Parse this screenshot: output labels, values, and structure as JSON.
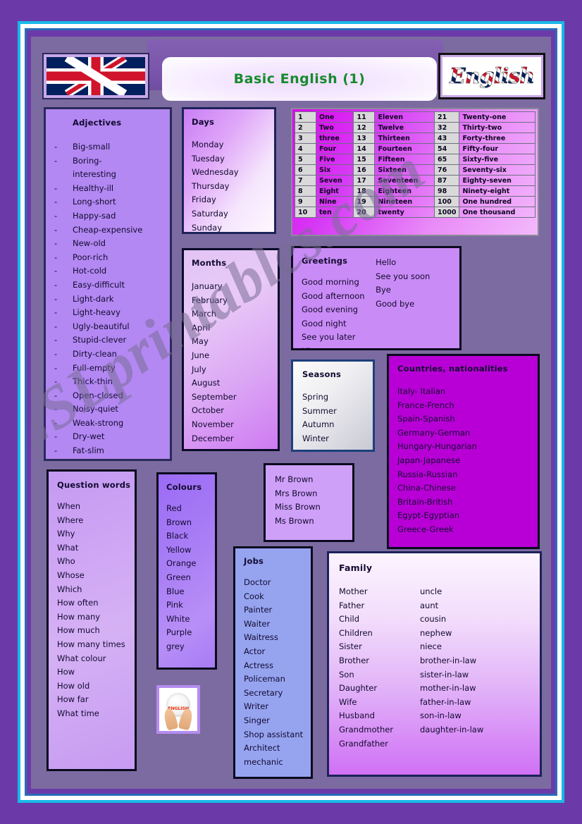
{
  "header": {
    "title": "Basic English (1)",
    "logo_text": "English",
    "flag_icon": "uk-flag-icon"
  },
  "colors": {
    "page_bg": "#6b3aa8",
    "frame_cyan": "#19b9e8",
    "frame_blue": "#2b6cb8",
    "canvas_bg": "#7c6ba0",
    "title_green": "#178a2e",
    "countries_magenta": "#b800d6",
    "jobs_blue": "#96a4f0"
  },
  "watermark": "ESLprintables.com",
  "adjectives": {
    "title": "Adjectives",
    "items": [
      "Big-small",
      "Boring-",
      "interesting",
      "Healthy-ill",
      "Long-short",
      "Happy-sad",
      "Cheap-expensive",
      "New-old",
      "Poor-rich",
      "Hot-cold",
      "Easy-difficult",
      "Light-dark",
      "Light-heavy",
      "Ugly-beautiful",
      "Stupid-clever",
      "Dirty-clean",
      "Full-empty",
      "Thick-thin",
      "Open-closed",
      "Noisy-quiet",
      "Weak-strong",
      "Dry-wet",
      "Fat-slim"
    ],
    "dashed": [
      true,
      true,
      false,
      true,
      true,
      true,
      true,
      true,
      true,
      true,
      true,
      true,
      true,
      true,
      true,
      true,
      true,
      true,
      true,
      true,
      true,
      true,
      true
    ]
  },
  "days": {
    "title": "Days",
    "items": [
      "Monday",
      "Tuesday",
      "Wednesday",
      "Thursday",
      "Friday",
      "Saturday",
      "Sunday"
    ]
  },
  "months": {
    "title": "Months",
    "items": [
      "January",
      "February",
      "March",
      "April",
      "May",
      "June",
      "July",
      "August",
      "September",
      "October",
      "November",
      "December"
    ]
  },
  "numbers": {
    "rows": [
      [
        "1",
        "One",
        "11",
        "Eleven",
        "21",
        "Twenty-one"
      ],
      [
        "2",
        "Two",
        "12",
        "Twelve",
        "32",
        "Thirty-two"
      ],
      [
        "3",
        "three",
        "13",
        "Thirteen",
        "43",
        "Forty-three"
      ],
      [
        "4",
        "Four",
        "14",
        "Fourteen",
        "54",
        "Fifty-four"
      ],
      [
        "5",
        "Five",
        "15",
        "Fifteen",
        "65",
        "Sixty-five"
      ],
      [
        "6",
        "Six",
        "16",
        "Sixteen",
        "76",
        "Seventy-six"
      ],
      [
        "7",
        "Seven",
        "17",
        "Seventeen",
        "87",
        "Eighty-seven"
      ],
      [
        "8",
        "Eight",
        "18",
        "Eighteen",
        "98",
        "Ninety-eight"
      ],
      [
        "9",
        "Nine",
        "19",
        "Nineteen",
        "100",
        "One hundred"
      ],
      [
        "10",
        "ten",
        "20",
        "twenty",
        "1000",
        "One thousand"
      ]
    ]
  },
  "greetings": {
    "title": "Greetings",
    "col1": [
      "Good morning",
      "Good afternoon",
      "Good evening",
      "Good night",
      "See you later",
      "Hi"
    ],
    "col2": [
      "Hello",
      "See you soon",
      "Bye",
      "Good bye"
    ]
  },
  "seasons": {
    "title": "Seasons",
    "items": [
      "Spring",
      "Summer",
      "Autumn",
      "Winter"
    ]
  },
  "countries": {
    "title": "Countries, nationalities",
    "items": [
      "Italy- Italian",
      "France-French",
      "Spain-Spanish",
      "Germany-German",
      "Hungary-Hungarian",
      "Japan-Japanese",
      "Russia-Russian",
      "China-Chinese",
      "Britain-British",
      "Egypt-Egyptian",
      "Greece-Greek"
    ]
  },
  "titles": {
    "items": [
      "Mr Brown",
      "Mrs Brown",
      "Miss Brown",
      "Ms Brown"
    ]
  },
  "question_words": {
    "title": "Question words",
    "items": [
      "When",
      "Where",
      "Why",
      "What",
      "Who",
      "Whose",
      "Which",
      "How often",
      "How many",
      "How much",
      "How many times",
      "What colour",
      "How",
      "How old",
      "How far",
      "What time"
    ]
  },
  "colours": {
    "title": "Colours",
    "items": [
      "Red",
      "Brown",
      "Black",
      "Yellow",
      "Orange",
      "Green",
      "Blue",
      "Pink",
      "White",
      "Purple",
      "grey"
    ]
  },
  "jobs": {
    "title": "Jobs",
    "items": [
      "Doctor",
      "Cook",
      "Painter",
      "Waiter",
      "Waitress",
      "Actor",
      "Actress",
      "Policeman",
      "Secretary",
      "Writer",
      "Singer",
      "Shop assistant",
      "Architect",
      "mechanic"
    ]
  },
  "family": {
    "title": "Family",
    "col1": [
      "Mother",
      "Father",
      "Child",
      "Children",
      "Sister",
      "Brother",
      "Son",
      "Daughter",
      "Wife",
      "Husband",
      "Grandmother",
      "Grandfather"
    ],
    "col2": [
      "uncle",
      "aunt",
      "cousin",
      "nephew",
      "niece",
      "brother-in-law",
      "sister-in-law",
      "mother-in-law",
      "father-in-law",
      "son-in-law",
      "daughter-in-law"
    ]
  },
  "globe_picture": {
    "word": "ENGLISH",
    "alt": "hands-holding-english-globe"
  }
}
